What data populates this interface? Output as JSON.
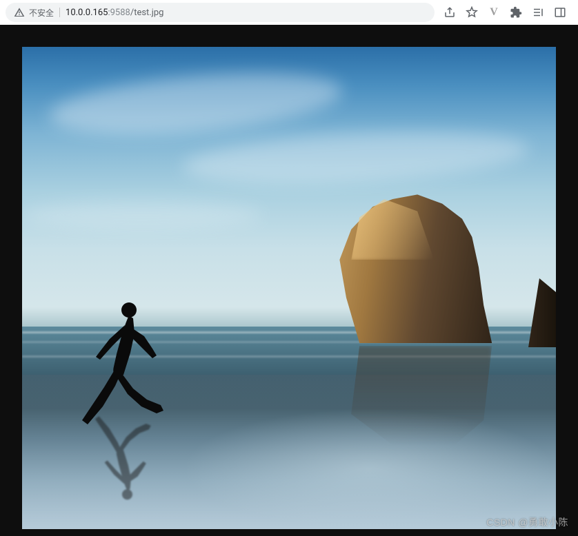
{
  "address_bar": {
    "security_label": "不安全",
    "url_host": "10.0.0.165",
    "url_port": ":9588",
    "url_path": "/test.jpg"
  },
  "toolbar": {
    "share_icon": "share-icon",
    "bookmark_icon": "star-icon",
    "v_icon": "V",
    "extensions_icon": "puzzle-icon",
    "reading_list_icon": "reading-list-icon",
    "side_panel_icon": "side-panel-icon"
  },
  "content": {
    "watermark": "CSDN @勇敢小陈"
  }
}
